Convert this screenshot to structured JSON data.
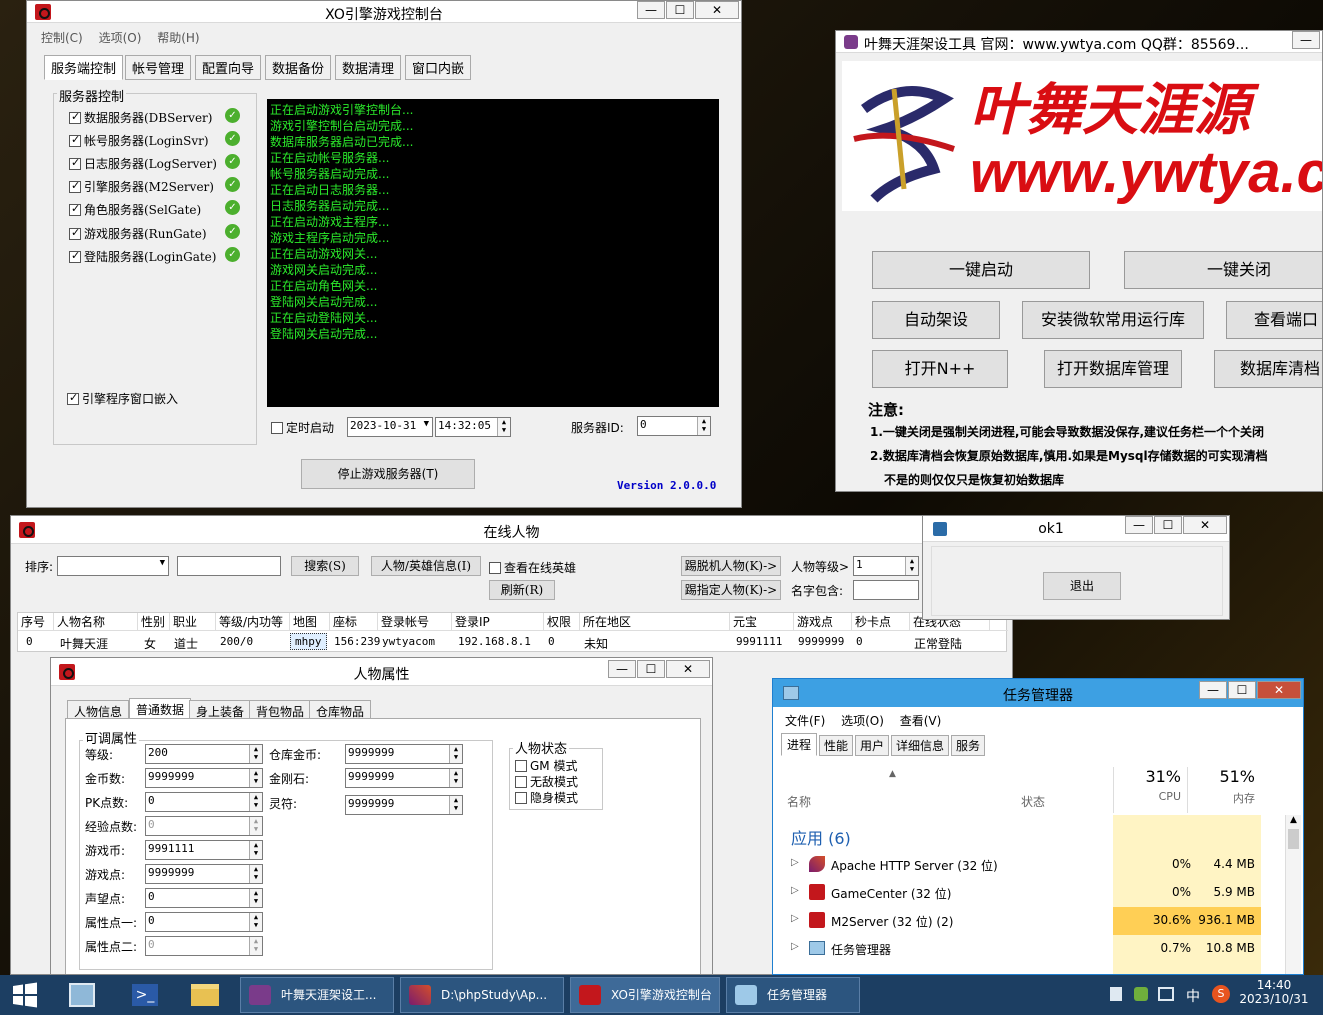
{
  "colors": {
    "accent_green": "#2bea2b",
    "console_bg": "#000000",
    "brand_red": "#c3171c",
    "taskbar": "#1c3e62",
    "version_blue": "#0000c8"
  },
  "xo": {
    "title": "XO引擎游戏控制台",
    "menu": [
      "控制(C)",
      "选项(O)",
      "帮助(H)"
    ],
    "tabs": [
      "服务端控制",
      "帐号管理",
      "配置向导",
      "数据备份",
      "数据清理",
      "窗口内嵌"
    ],
    "group_title": "服务器控制",
    "servers": [
      "数据服务器(DBServer)",
      "帐号服务器(LoginSvr)",
      "日志服务器(LogServer)",
      "引擎服务器(M2Server)",
      "角色服务器(SelGate)",
      "游戏服务器(RunGate)",
      "登陆服务器(LoginGate)"
    ],
    "embed_label": "引擎程序窗口嵌入",
    "console": [
      "正在启动游戏引擎控制台...",
      "游戏引擎控制台启动完成...",
      "数据库服务器启动已完成...",
      "正在启动帐号服务器...",
      "帐号服务器启动完成...",
      "正在启动日志服务器...",
      "日志服务器启动完成...",
      "正在启动游戏主程序...",
      "游戏主程序启动完成...",
      "正在启动游戏网关...",
      "游戏网关启动完成...",
      "正在启动角色网关...",
      "登陆网关启动完成...",
      "正在启动登陆网关...",
      "登陆网关启动完成..."
    ],
    "timer_label": "定时启动",
    "date": "2023-10-31",
    "time": "14:32:05",
    "server_id_label": "服务器ID:",
    "server_id": "0",
    "stop_button": "停止游戏服务器(T)",
    "version": "Version 2.0.0.0"
  },
  "yw": {
    "title": "叶舞天涯架设工具  官网：www.ywtya.com   QQ群：85569...",
    "banner_text": "叶舞天涯源",
    "banner_url": "www.ywtya.co",
    "buttons": [
      "一键启动",
      "一键关闭",
      "自动架设",
      "安装微软常用运行库",
      "查看端口",
      "打开N++",
      "打开数据库管理",
      "数据库清档"
    ],
    "notice_title": "注意:",
    "notice": [
      "1.一键关闭是强制关闭进程,可能会导致数据没保存,建议任务栏一个个关闭",
      "2.数据库清档会恢复原始数据库,慎用.如果是Mysql存储数据的可实现清档",
      "不是的则仅仅只是恢复初始数据库"
    ]
  },
  "online": {
    "title": "在线人物",
    "sort_label": "排序:",
    "search_button": "搜索(S)",
    "hero_info_button": "人物/英雄信息(I)",
    "view_hero_label": "查看在线英雄",
    "kick_offline_button": "踢脱机人物(K)->",
    "level_label": "人物等级>",
    "level_value": "1",
    "refresh_button": "刷新(R)",
    "kick_named_button": "踢指定人物(K)->",
    "name_contains_label": "名字包含:",
    "columns": [
      "序号",
      "人物名称",
      "性别",
      "职业",
      "等级/内功等",
      "地图",
      "座标",
      "登录帐号",
      "登录IP",
      "权限",
      "所在地区",
      "元宝",
      "游戏点",
      "秒卡点",
      "在线状态"
    ],
    "row": [
      "0",
      "叶舞天涯",
      "女",
      "道士",
      "200/0",
      "mhpy",
      "156:239",
      "ywtyacom",
      "192.168.8.1",
      "0",
      "未知",
      "9991111",
      "9999999",
      "0",
      "正常登陆"
    ]
  },
  "ok1": {
    "title": "ok1",
    "exit_button": "退出"
  },
  "attr": {
    "title": "人物属性",
    "tabs": [
      "人物信息",
      "普通数据",
      "身上装备",
      "背包物品",
      "仓库物品"
    ],
    "group_title": "可调属性",
    "fields": [
      {
        "label": "等级:",
        "value": "200",
        "enabled": true
      },
      {
        "label": "金币数:",
        "value": "9999999",
        "enabled": true
      },
      {
        "label": "PK点数:",
        "value": "0",
        "enabled": true
      },
      {
        "label": "经验点数:",
        "value": "0",
        "enabled": false
      },
      {
        "label": "游戏币:",
        "value": "9991111",
        "enabled": true
      },
      {
        "label": "游戏点:",
        "value": "9999999",
        "enabled": true
      },
      {
        "label": "声望点:",
        "value": "0",
        "enabled": true
      },
      {
        "label": "属性点一:",
        "value": "0",
        "enabled": true
      },
      {
        "label": "属性点二:",
        "value": "0",
        "enabled": false
      }
    ],
    "fields2": [
      {
        "label": "仓库金币:",
        "value": "9999999"
      },
      {
        "label": "金刚石:",
        "value": "9999999"
      },
      {
        "label": "灵符:",
        "value": "9999999"
      }
    ],
    "status_title": "人物状态",
    "status": [
      "GM 模式",
      "无敌模式",
      "隐身模式"
    ]
  },
  "tm": {
    "title": "任务管理器",
    "menu": [
      "文件(F)",
      "选项(O)",
      "查看(V)"
    ],
    "tabs": [
      "进程",
      "性能",
      "用户",
      "详细信息",
      "服务"
    ],
    "col_name": "名称",
    "col_status": "状态",
    "cpu_pct": "31%",
    "mem_pct": "51%",
    "cpu_label": "CPU",
    "mem_label": "内存",
    "group": "应用 (6)",
    "rows": [
      {
        "name": "Apache HTTP Server (32 位)",
        "cpu": "0%",
        "mem": "4.4 MB"
      },
      {
        "name": "GameCenter (32 位)",
        "cpu": "0%",
        "mem": "5.9 MB"
      },
      {
        "name": "M2Server (32 位) (2)",
        "cpu": "30.6%",
        "mem": "936.1 MB"
      },
      {
        "name": "任务管理器",
        "cpu": "0.7%",
        "mem": "10.8 MB"
      }
    ]
  },
  "taskbar": {
    "items": [
      "叶舞天涯架设工...",
      "D:\\phpStudy\\Ap...",
      "XO引擎游戏控制台",
      "任务管理器"
    ],
    "time": "14:40",
    "date": "2023/10/31",
    "ime": "中"
  }
}
